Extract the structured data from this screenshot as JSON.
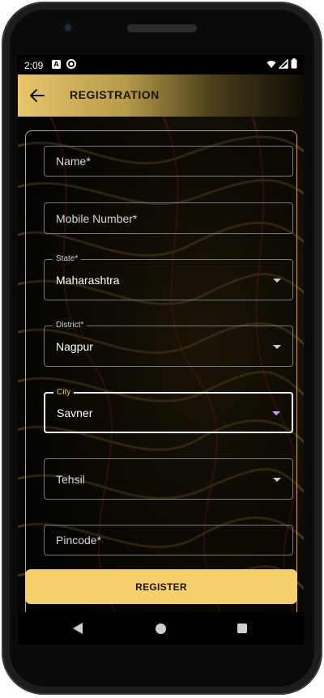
{
  "status_bar": {
    "time": "2:09",
    "icons": [
      "a-notification-icon",
      "at-sign-icon",
      "wifi-icon",
      "signal-icon",
      "battery-icon"
    ]
  },
  "app_bar": {
    "title": "REGISTRATION",
    "back_icon": "arrow-left-icon"
  },
  "form": {
    "name": {
      "placeholder": "Name*",
      "value": ""
    },
    "mobile": {
      "placeholder": "Mobile Number*",
      "value": ""
    },
    "state": {
      "label": "State*",
      "value": "Maharashtra"
    },
    "district": {
      "label": "District*",
      "value": "Nagpur"
    },
    "city": {
      "label": "City",
      "value": "Savner"
    },
    "tehsil": {
      "placeholder": "Tehsil",
      "value": ""
    },
    "pincode": {
      "placeholder": "Pincode*",
      "value": ""
    }
  },
  "register_button": {
    "label": "REGISTER"
  },
  "colors": {
    "accent": "#F5CF6A",
    "card_border": "#C9A758",
    "active_caret": "#C9A2FF"
  },
  "nav_bar": {
    "icons": [
      "back-triangle-icon",
      "home-circle-icon",
      "recents-square-icon"
    ]
  }
}
